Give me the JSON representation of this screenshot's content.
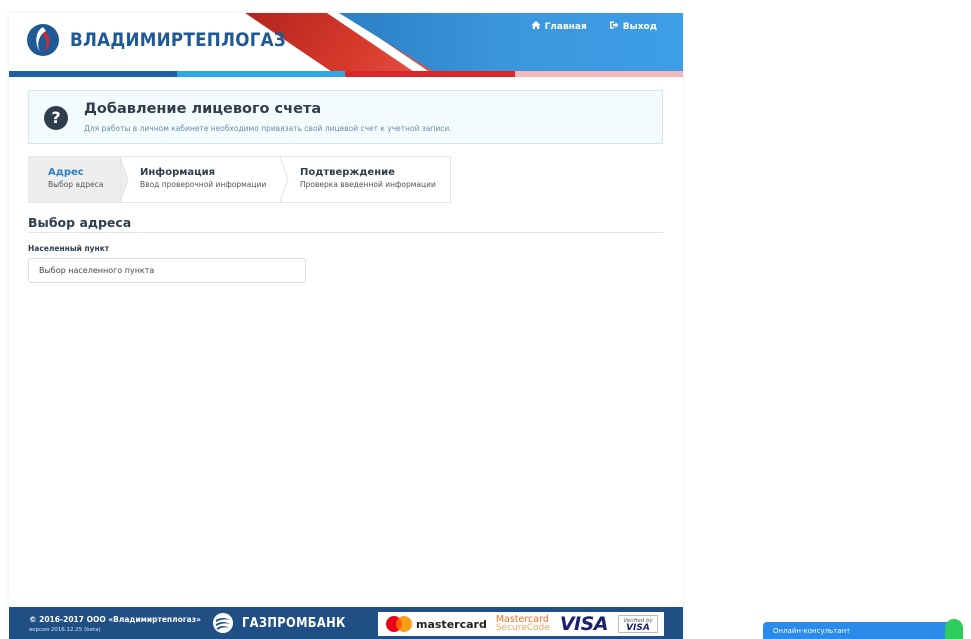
{
  "header": {
    "brand": "ВЛАДИМИРТЕПЛОГАЗ",
    "nav": [
      {
        "label": "Главная",
        "icon": "home-icon"
      },
      {
        "label": "Выход",
        "icon": "logout-icon"
      }
    ]
  },
  "info": {
    "icon": "question-icon",
    "title": "Добавление лицевого счета",
    "subtitle": "Для работы в личном кабинете необходимо привязать свой лицевой счет к учетной записи."
  },
  "steps": [
    {
      "title": "Адрес",
      "desc": "Выбор адреса",
      "active": true
    },
    {
      "title": "Информация",
      "desc": "Ввод проверочной информации",
      "active": false
    },
    {
      "title": "Подтверждение",
      "desc": "Проверка введенной информации",
      "active": false
    }
  ],
  "section": {
    "title": "Выбор адреса",
    "field_label": "Населенный пункт",
    "field_value": "Выбор населенного пункта"
  },
  "footer": {
    "copyright": "© 2016-2017 ООО «Владимиртеплогаз»",
    "version": "версия 2016.12.25 (beta)",
    "bank": "ГАЗПРОМБАНК",
    "mastercard": "mastercard",
    "securecode_top": "Mastercard",
    "securecode_bottom": "SecureCode",
    "visa": "VISA",
    "vbv_top": "Verified by",
    "vbv_bottom": "VISA"
  },
  "chat": {
    "label": "Онлайн-консультант"
  },
  "colors": {
    "brand_blue": "#1f5a97",
    "accent_blue": "#2c7fc3",
    "brand_red": "#d8262b",
    "footer_bg": "#1f4f85",
    "chat_bg": "#2a8bea",
    "chat_status": "#2ecc5a"
  }
}
